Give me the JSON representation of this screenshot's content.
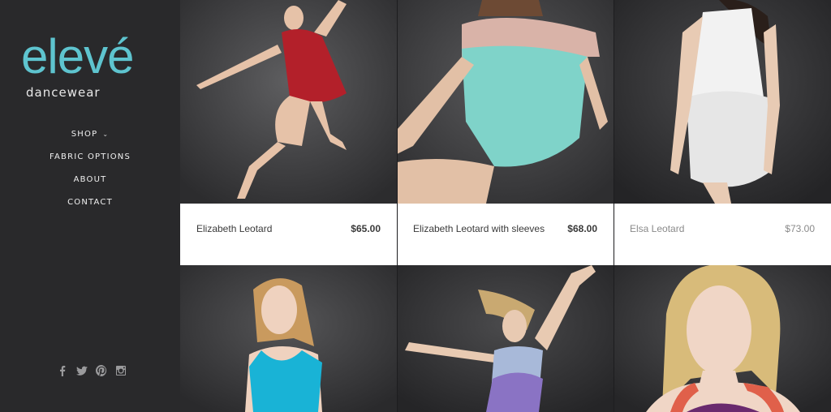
{
  "brand": {
    "name": "elevé",
    "tagline": "dancewear",
    "accent": "#5ec4cf"
  },
  "nav": {
    "items": [
      {
        "label": "SHOP",
        "has_dropdown": true
      },
      {
        "label": "FABRIC OPTIONS"
      },
      {
        "label": "ABOUT"
      },
      {
        "label": "CONTACT"
      }
    ]
  },
  "social": [
    "facebook-icon",
    "twitter-icon",
    "pinterest-icon",
    "instagram-icon"
  ],
  "products": [
    {
      "name": "Elizabeth Leotard",
      "price": "$65.00",
      "color": "#b3202a"
    },
    {
      "name": "Elizabeth Leotard with sleeves",
      "price": "$68.00",
      "color": "#7fd3c9"
    },
    {
      "name": "Elsa Leotard",
      "price": "$73.00",
      "color": "#f2f2f2"
    },
    {
      "color": "#19b3d6"
    },
    {
      "color": "#8a73c4"
    },
    {
      "color": "#e0604a"
    }
  ]
}
